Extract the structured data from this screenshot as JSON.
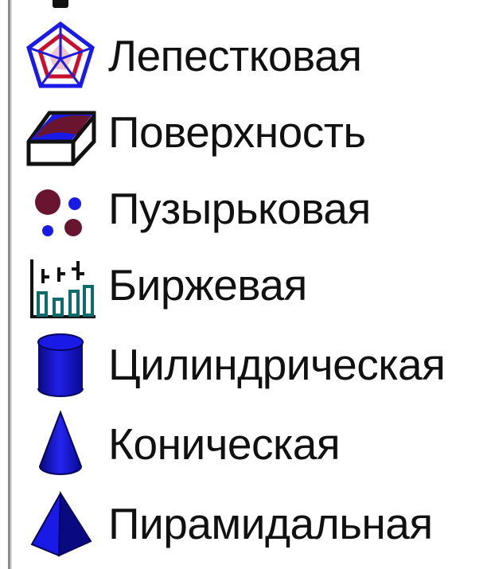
{
  "chart_type_list": {
    "items": [
      {
        "label": "Лепестковая",
        "icon": "radar-chart-icon"
      },
      {
        "label": "Поверхность",
        "icon": "surface-chart-icon"
      },
      {
        "label": "Пузырьковая",
        "icon": "bubble-chart-icon"
      },
      {
        "label": "Биржевая",
        "icon": "stock-chart-icon"
      },
      {
        "label": "Цилиндрическая",
        "icon": "cylinder-chart-icon"
      },
      {
        "label": "Коническая",
        "icon": "cone-chart-icon"
      },
      {
        "label": "Пирамидальная",
        "icon": "pyramid-chart-icon"
      }
    ]
  },
  "colors": {
    "text": "#111111",
    "icon_blue": "#1a1ae6",
    "icon_dark_blue": "#0a0a80",
    "icon_maroon": "#6a1530",
    "icon_teal": "#0e6b6b",
    "radar_red": "#c8102e"
  }
}
